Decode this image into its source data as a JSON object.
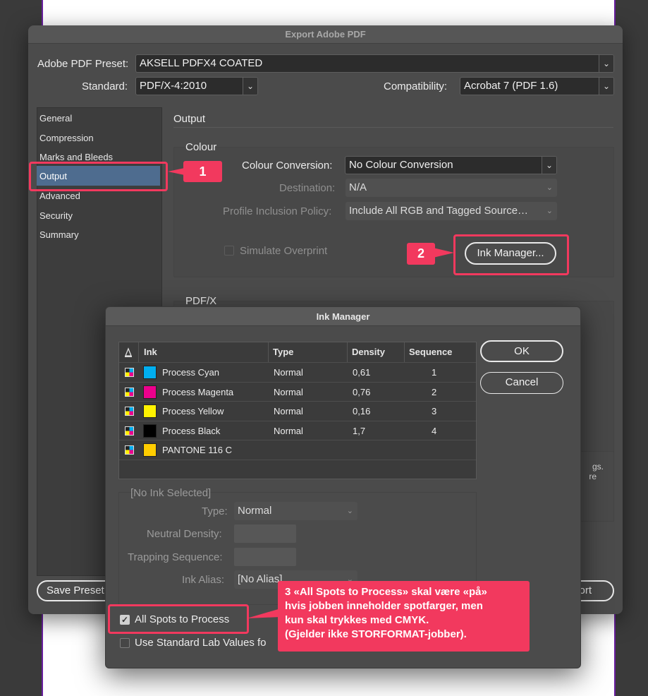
{
  "export_dialog": {
    "title": "Export Adobe PDF",
    "preset_label": "Adobe PDF Preset:",
    "preset_value": "AKSELL PDFX4 COATED",
    "standard_label": "Standard:",
    "standard_value": "PDF/X-4:2010",
    "compat_label": "Compatibility:",
    "compat_value": "Acrobat 7 (PDF 1.6)",
    "sidebar": [
      "General",
      "Compression",
      "Marks and Bleeds",
      "Output",
      "Advanced",
      "Security",
      "Summary"
    ],
    "section_title": "Output",
    "colour_heading": "Colour",
    "colour_conversion_label": "Colour Conversion:",
    "colour_conversion_value": "No Colour Conversion",
    "destination_label": "Destination:",
    "destination_value": "N/A",
    "profile_label": "Profile Inclusion Policy:",
    "profile_value": "Include All RGB and Tagged Source…",
    "simulate_label": "Simulate Overprint",
    "ink_manager_button": "Ink Manager...",
    "pdfx_heading": "PDF/X",
    "save_preset_button": "Save Preset...",
    "export_button_partial": "ort",
    "hidden_text_1": "gs.",
    "hidden_text_2": "re"
  },
  "ink_manager": {
    "title": "Ink Manager",
    "columns": [
      "Ink",
      "Type",
      "Density",
      "Sequence"
    ],
    "rows": [
      {
        "name": "Process Cyan",
        "type": "Normal",
        "density": "0,61",
        "sequence": "1",
        "color": "#00aeef"
      },
      {
        "name": "Process Magenta",
        "type": "Normal",
        "density": "0,76",
        "sequence": "2",
        "color": "#ec008c"
      },
      {
        "name": "Process Yellow",
        "type": "Normal",
        "density": "0,16",
        "sequence": "3",
        "color": "#fff200"
      },
      {
        "name": "Process Black",
        "type": "Normal",
        "density": "1,7",
        "sequence": "4",
        "color": "#000000"
      },
      {
        "name": "PANTONE 116 C",
        "type": "",
        "density": "",
        "sequence": "",
        "color": "#ffcd00"
      }
    ],
    "ok_button": "OK",
    "cancel_button": "Cancel",
    "no_ink_selected": "[No Ink Selected]",
    "type_label": "Type:",
    "type_value": "Normal",
    "neutral_density_label": "Neutral Density:",
    "trapping_sequence_label": "Trapping Sequence:",
    "ink_alias_label": "Ink Alias:",
    "ink_alias_value": "[No Alias]",
    "all_spots_label": "All Spots to Process",
    "all_spots_checked": true,
    "lab_values_label": "Use Standard Lab Values fo"
  },
  "annotations": {
    "tag1": "1",
    "tag2": "2",
    "callout3_line1": "3 «All Spots to Process» skal være «på»",
    "callout3_line2": "hvis jobben inneholder spotfarger, men",
    "callout3_line3": "kun skal trykkes med CMYK.",
    "callout3_line4": "(Gjelder ikke STORFORMAT-jobber).",
    "accent_color": "#f2395e"
  }
}
